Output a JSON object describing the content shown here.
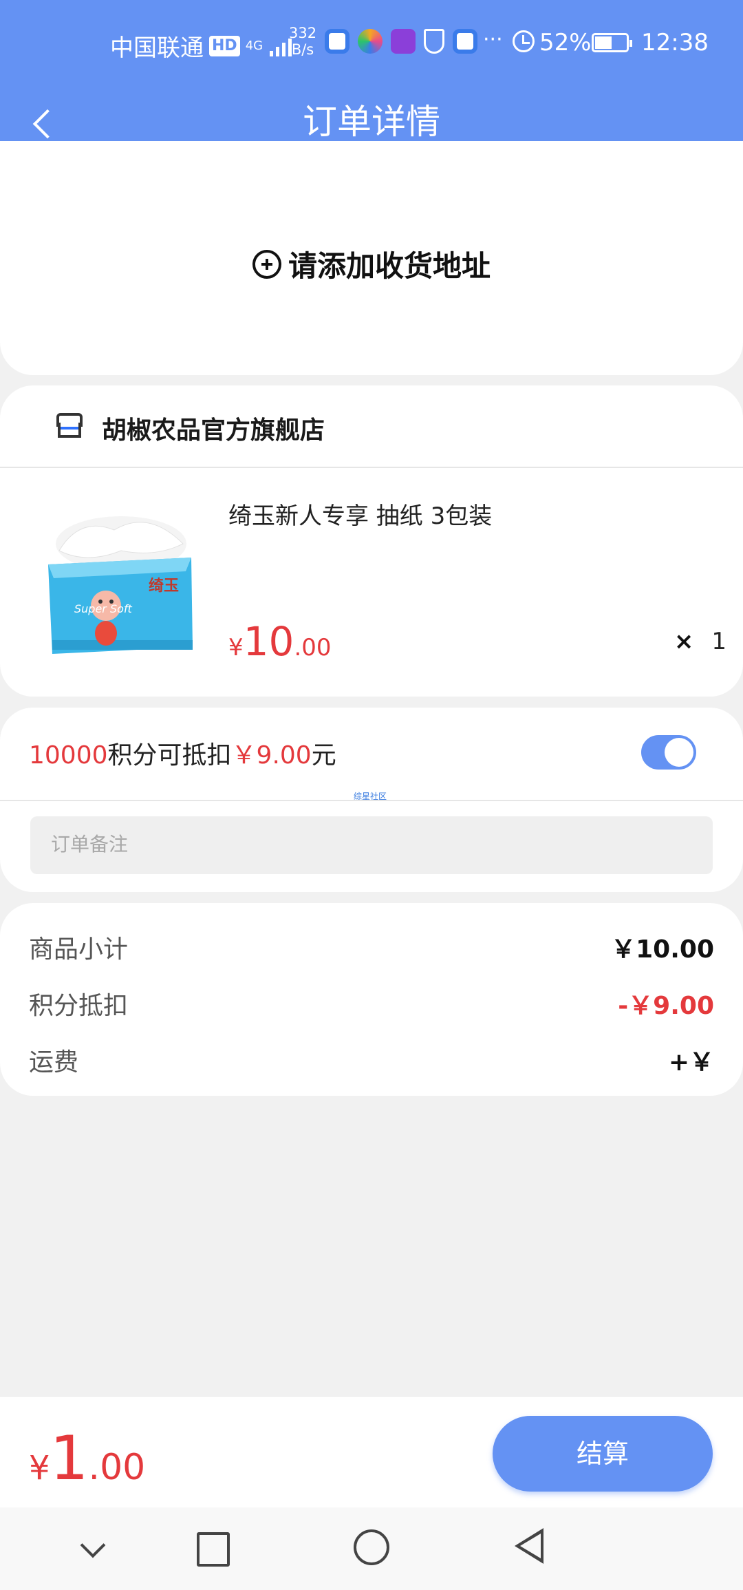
{
  "status_bar": {
    "carrier": "中国联通",
    "hd": "HD",
    "network": "4G",
    "speed_value": "332",
    "speed_unit": "B/s",
    "more": "···",
    "battery": "52%",
    "time": "12:38"
  },
  "header": {
    "title": "订单详情"
  },
  "address": {
    "add_label": "请添加收货地址"
  },
  "shop": {
    "name": "胡椒农品官方旗舰店",
    "product": {
      "name": "绮玉新人专享 抽纸 3包装",
      "currency": "¥",
      "price_int": "10",
      "price_dec": ".00",
      "qty_symbol": "×",
      "quantity": "1",
      "image_icon": "tissue-pack-image"
    }
  },
  "points": {
    "amount": "10000",
    "text_mid": "积分可抵扣",
    "deduct": "￥9.00",
    "unit": "元",
    "toggle_on": true,
    "watermark": "综星社区",
    "remark_placeholder": "订单备注"
  },
  "summary": {
    "rows": [
      {
        "label": "商品小计",
        "value": "￥10.00"
      },
      {
        "label": "积分抵扣",
        "value": "-￥9.00"
      },
      {
        "label": "运费",
        "value": "+￥"
      }
    ]
  },
  "footer": {
    "currency": "¥",
    "total_int": "1",
    "total_dec": ".00",
    "checkout_label": "结算"
  },
  "colors": {
    "primary": "#6492f3",
    "price_red": "#e4393c"
  }
}
